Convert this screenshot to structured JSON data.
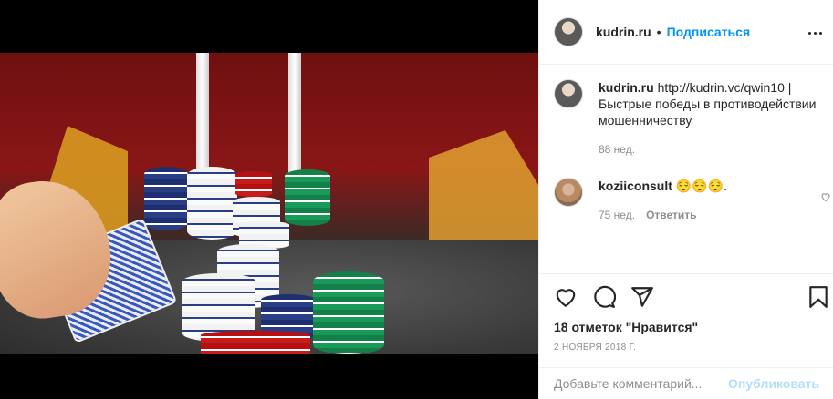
{
  "post": {
    "author": "kudrin.ru",
    "separator": "•",
    "follow_label": "Подписаться",
    "more_icon": "more-options-icon"
  },
  "caption": {
    "author": "kudrin.ru",
    "text": "http://kudrin.vc/qwin10 | Быстрые победы в противодействии мошенничеству",
    "age": "88 нед."
  },
  "comments": [
    {
      "author": "koziiconsult",
      "text": "😌😌😌.",
      "age": "75 нед.",
      "reply_label": "Ответить"
    }
  ],
  "actions": {
    "icons": [
      "heart-icon",
      "comment-icon",
      "share-icon",
      "bookmark-icon"
    ],
    "likes": "18 отметок \"Нравится\"",
    "date": "2 НОЯБРЯ 2018 Г."
  },
  "add_comment": {
    "placeholder": "Добавьте комментарий...",
    "publish_label": "Опубликовать"
  }
}
